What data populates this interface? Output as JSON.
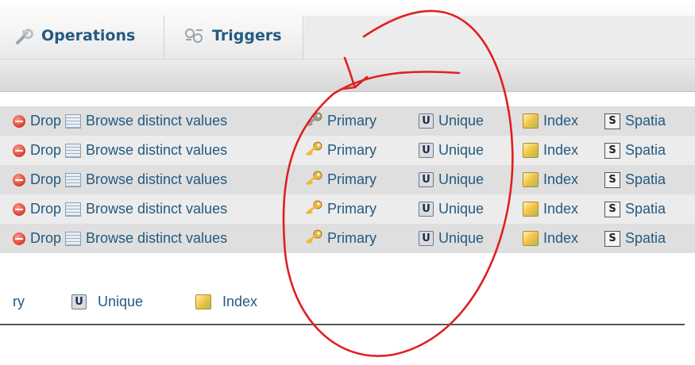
{
  "tabs": {
    "operations": {
      "label": "Operations",
      "icon": "wrench-icon"
    },
    "triggers": {
      "label": "Triggers",
      "icon": "triggers-icon"
    }
  },
  "rows": [
    {
      "drop": "Drop",
      "browse": "Browse distinct values",
      "primary": "Primary",
      "primary_enabled": false,
      "unique": "Unique",
      "index": "Index",
      "spatial": "Spatia"
    },
    {
      "drop": "Drop",
      "browse": "Browse distinct values",
      "primary": "Primary",
      "primary_enabled": true,
      "unique": "Unique",
      "index": "Index",
      "spatial": "Spatia"
    },
    {
      "drop": "Drop",
      "browse": "Browse distinct values",
      "primary": "Primary",
      "primary_enabled": true,
      "unique": "Unique",
      "index": "Index",
      "spatial": "Spatia"
    },
    {
      "drop": "Drop",
      "browse": "Browse distinct values",
      "primary": "Primary",
      "primary_enabled": true,
      "unique": "Unique",
      "index": "Index",
      "spatial": "Spatia"
    },
    {
      "drop": "Drop",
      "browse": "Browse distinct values",
      "primary": "Primary",
      "primary_enabled": true,
      "unique": "Unique",
      "index": "Index",
      "spatial": "Spatia"
    }
  ],
  "bottom": {
    "primary_partial": "ry",
    "unique": "Unique",
    "index": "Index"
  },
  "icons": {
    "unique_glyph": "U",
    "spatial_glyph": "S"
  },
  "colors": {
    "link": "#235a81",
    "annotation": "#e02020",
    "key_enabled": "#f0b93a",
    "key_disabled": "#9a9a9a"
  }
}
